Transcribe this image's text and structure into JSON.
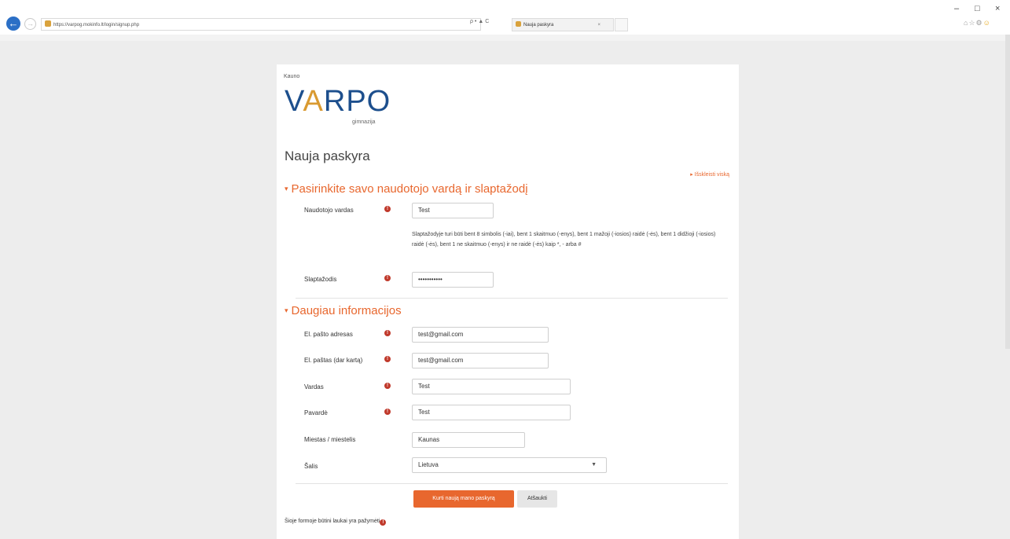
{
  "browser": {
    "url": "https://varpog.mokinfo.lt/login/signup.php",
    "address_tools": "ρ • ▲ C",
    "tab_title": "Nauja paskyra",
    "tab_close": "×",
    "minimize": "–",
    "restore": "□",
    "close": "×"
  },
  "logo": {
    "small": "Kauno",
    "main_before": "V",
    "main_mark": "A",
    "main_after": "RPO",
    "sub": "gimnazija"
  },
  "page": {
    "title": "Nauja paskyra",
    "expand_all": "▸ Išskleisti viską"
  },
  "section1": {
    "title": "Pasirinkite savo naudotojo vardą ir slaptažodį",
    "username_label": "Naudotojo vardas",
    "username_value": "Test",
    "password_note": "Slaptažodyje turi būti bent 8 simbolis (-iai), bent 1 skaitmuo (-enys), bent 1 mažoji (-iosios) raidė (-ės), bent 1 didžioji (-iosios) raidė (-ės), bent 1 ne skaitmuo (-enys) ir ne raidė (-ės) kaip *, - arba #",
    "password_label": "Slaptažodis",
    "password_value": "•••••••••••"
  },
  "section2": {
    "title": "Daugiau informacijos",
    "email_label": "El. pašto adresas",
    "email_value": "test@gmail.com",
    "email2_label": "El. paštas (dar kartą)",
    "email2_value": "test@gmail.com",
    "firstname_label": "Vardas",
    "firstname_value": "Test",
    "lastname_label": "Pavardė",
    "lastname_value": "Test",
    "city_label": "Miestas / miestelis",
    "city_value": "Kaunas",
    "country_label": "Šalis",
    "country_value": "Lietuva"
  },
  "buttons": {
    "create": "Kurti naują mano paskyrą",
    "cancel": "Atšaukti"
  },
  "footer": {
    "required_note": "Šioje formoje būtini laukai yra pažymėti"
  },
  "colors": {
    "accent": "#e8672e",
    "required": "#c0392b",
    "logo_blue": "#1d4f8d",
    "logo_gold": "#d99a31"
  }
}
